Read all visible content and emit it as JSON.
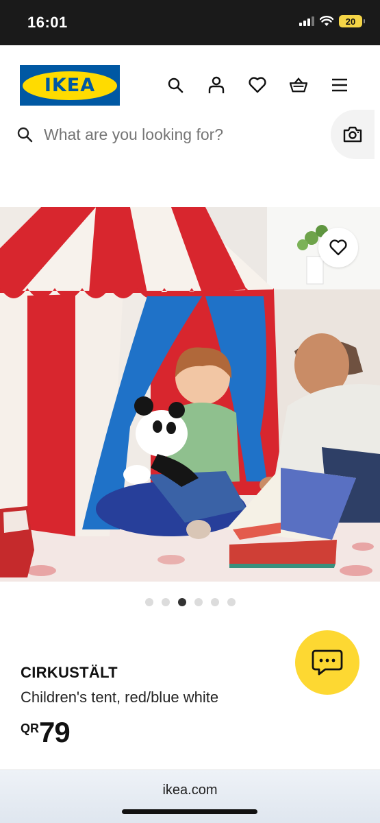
{
  "status_bar": {
    "time": "16:01",
    "battery": "20"
  },
  "header": {
    "logo_text": "IKEA",
    "icons": [
      "search-icon",
      "account-icon",
      "heart-icon",
      "basket-icon",
      "menu-icon"
    ]
  },
  "search": {
    "placeholder": "What are you looking for?"
  },
  "gallery": {
    "total_images": 6,
    "active_index": 2
  },
  "product": {
    "name": "CIRKUSTÄLT",
    "description": "Children's tent, red/blue white",
    "currency": "QR",
    "price": "79"
  },
  "browser": {
    "url": "ikea.com"
  },
  "colors": {
    "ikea_blue": "#0058a3",
    "ikea_yellow": "#ffdb00",
    "chat_yellow": "#fdd832",
    "tent_red": "#d8262e",
    "tent_blue": "#1f72c8"
  }
}
